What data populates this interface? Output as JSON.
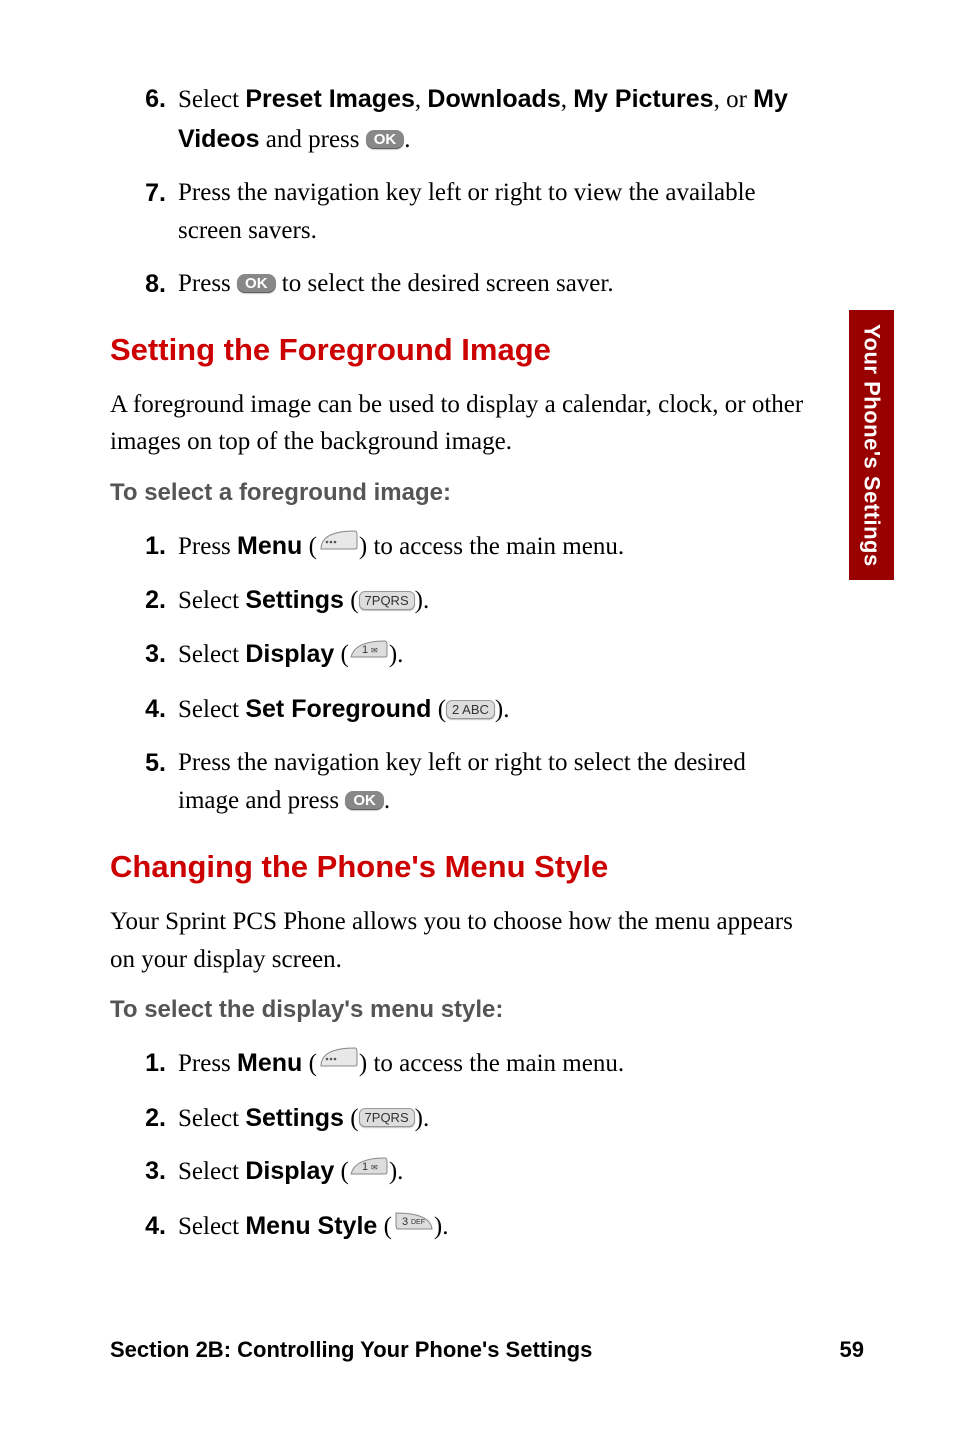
{
  "side_tab": "Your Phone's Settings",
  "top_steps": {
    "s6": {
      "num": "6.",
      "prefix": "Select ",
      "b1": "Preset Images",
      "b2": "Downloads",
      "b3": "My Pictures",
      "or": ", or ",
      "b4": "My Videos",
      "after": " and press ",
      "ok": "OK",
      "end": "."
    },
    "s7": {
      "num": "7.",
      "text": "Press the navigation key left or right to view the available screen savers."
    },
    "s8": {
      "num": "8.",
      "prefix": "Press ",
      "ok": "OK",
      "after": " to select the desired screen saver."
    }
  },
  "h1": "Setting the Foreground Image",
  "p1": "A foreground image can be used to display a calendar, clock, or other images on top of the background image.",
  "sub1": "To select a foreground image:",
  "fg_steps": {
    "s1": {
      "num": "1.",
      "prefix": "Press ",
      "bold": "Menu",
      "after": " (",
      "close": ") to access the main menu."
    },
    "s2": {
      "num": "2.",
      "prefix": "Select ",
      "bold": "Settings",
      "after": " (",
      "key": "7PQRS",
      "close": ")."
    },
    "s3": {
      "num": "3.",
      "prefix": "Select ",
      "bold": "Display",
      "after": " (",
      "key": "1",
      "close": ")."
    },
    "s4": {
      "num": "4.",
      "prefix": "Select ",
      "bold": "Set Foreground",
      "after": " (",
      "key": "2 ABC",
      "close": ")."
    },
    "s5": {
      "num": "5.",
      "text1": "Press the navigation key left or right to select the desired image and press ",
      "ok": "OK",
      "end": "."
    }
  },
  "h2": "Changing the Phone's Menu Style",
  "p2": "Your Sprint PCS Phone allows you to choose how the menu appears on your display screen.",
  "sub2": "To select the display's menu style:",
  "ms_steps": {
    "s1": {
      "num": "1.",
      "prefix": "Press ",
      "bold": "Menu",
      "after": " (",
      "close": ") to access the main menu."
    },
    "s2": {
      "num": "2.",
      "prefix": "Select ",
      "bold": "Settings",
      "after": " (",
      "key": "7PQRS",
      "close": ")."
    },
    "s3": {
      "num": "3.",
      "prefix": "Select ",
      "bold": "Display",
      "after": " (",
      "key": "1",
      "close": ")."
    },
    "s4": {
      "num": "4.",
      "prefix": "Select ",
      "bold": "Menu Style",
      "after": " (",
      "key": "3 DEF",
      "close": ")."
    }
  },
  "footer_left": "Section 2B: Controlling Your Phone's Settings",
  "footer_right": "59"
}
